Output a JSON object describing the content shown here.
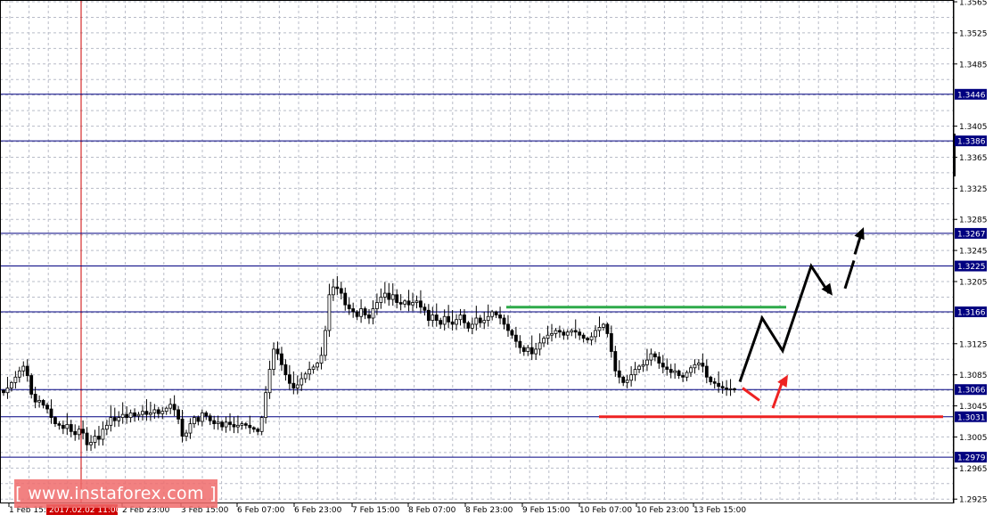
{
  "chart_data": {
    "type": "candlestick",
    "instrument_hint": "GBP/USD H1",
    "colors": {
      "candle": "#000000",
      "grid": "#b8bcc8",
      "level_line": "#000080",
      "tag_bg": "#000080",
      "crosshair": "#cc0000",
      "cursor_tag_bg": "#cc0000",
      "resistance_mark": "#2eaa4a",
      "support_mark": "#ee2222",
      "main_arrow": "#000000",
      "alt_arrow": "#ee2222"
    },
    "ylim": [
      1.2925,
      1.3575
    ],
    "y_ticks": [
      "1.3565",
      "1.3525",
      "1.3485",
      "1.3405",
      "1.3365",
      "1.3325",
      "1.3285",
      "1.3245",
      "1.3205",
      "1.3125",
      "1.3085",
      "1.3045",
      "1.3005",
      "1.2965",
      "1.2925"
    ],
    "x_ticks": [
      "1 Feb 15:00",
      "2 Feb 23:00",
      "3 Feb 15:00",
      "6 Feb 07:00",
      "6 Feb 23:00",
      "7 Feb 15:00",
      "8 Feb 07:00",
      "8 Feb 23:00",
      "9 Feb 15:00",
      "10 Feb 07:00",
      "10 Feb 23:00",
      "13 Feb 15:00"
    ],
    "cursor_time_label": "2017.02.02 11:00",
    "levels": [
      {
        "label": "1.3446",
        "value": 1.3446
      },
      {
        "label": "1.3386",
        "value": 1.3386
      },
      {
        "label": "1.3267",
        "value": 1.3267
      },
      {
        "label": "1.3225",
        "value": 1.3225
      },
      {
        "label": "1.3166",
        "value": 1.3166
      },
      {
        "label": "1.3066",
        "value": 1.3066
      },
      {
        "label": "1.3031",
        "value": 1.3031
      },
      {
        "label": "1.2979",
        "value": 1.2979
      }
    ],
    "resistance_zone": {
      "value": 1.3172
    },
    "support_zone": {
      "value": 1.3031
    },
    "closes": [
      1.3062,
      1.3068,
      1.3075,
      1.3082,
      1.309,
      1.3096,
      1.3084,
      1.306,
      1.305,
      1.3052,
      1.3046,
      1.3041,
      1.303,
      1.3022,
      1.302,
      1.3016,
      1.3021,
      1.3012,
      1.3008,
      1.3015,
      1.301,
      1.2995,
      1.2998,
      1.3006,
      1.3002,
      1.3015,
      1.302,
      1.303,
      1.3026,
      1.303,
      1.3034,
      1.303,
      1.3036,
      1.3032,
      1.3034,
      1.3038,
      1.3034,
      1.3036,
      1.304,
      1.3035,
      1.3038,
      1.3042,
      1.3047,
      1.304,
      1.3028,
      1.3006,
      1.301,
      1.3022,
      1.303,
      1.3025,
      1.3036,
      1.3032,
      1.3026,
      1.3022,
      1.3024,
      1.3018,
      1.3024,
      1.3021,
      1.3018,
      1.302,
      1.3022,
      1.302,
      1.3017,
      1.3015,
      1.3012,
      1.303,
      1.3062,
      1.3092,
      1.3118,
      1.3112,
      1.3098,
      1.3085,
      1.3074,
      1.3068,
      1.3072,
      1.308,
      1.3086,
      1.3092,
      1.3095,
      1.31,
      1.311,
      1.3142,
      1.3188,
      1.3198,
      1.3196,
      1.319,
      1.3175,
      1.317,
      1.3166,
      1.316,
      1.317,
      1.3162,
      1.3158,
      1.317,
      1.3178,
      1.3185,
      1.319,
      1.3182,
      1.3188,
      1.3178,
      1.3176,
      1.318,
      1.3175,
      1.3178,
      1.318,
      1.3172,
      1.3168,
      1.3155,
      1.3162,
      1.3155,
      1.315,
      1.316,
      1.3153,
      1.315,
      1.3156,
      1.3162,
      1.3152,
      1.3145,
      1.315,
      1.3158,
      1.3152,
      1.3155,
      1.316,
      1.3166,
      1.3162,
      1.3158,
      1.315,
      1.3142,
      1.3136,
      1.3128,
      1.312,
      1.3115,
      1.312,
      1.3112,
      1.3118,
      1.3126,
      1.3132,
      1.3136,
      1.3138,
      1.3142,
      1.314,
      1.3136,
      1.314,
      1.3142,
      1.314,
      1.3136,
      1.3132,
      1.313,
      1.3134,
      1.3142,
      1.3146,
      1.315,
      1.3138,
      1.3115,
      1.309,
      1.3082,
      1.3075,
      1.3078,
      1.3085,
      1.3092,
      1.3096,
      1.3098,
      1.3104,
      1.3112,
      1.3108,
      1.31,
      1.3095,
      1.3092,
      1.3088,
      1.309,
      1.3084,
      1.3082,
      1.3088,
      1.3094,
      1.3098,
      1.31,
      1.3096,
      1.3082,
      1.3076,
      1.3074,
      1.307,
      1.3068,
      1.3066,
      1.3067,
      1.3066
    ],
    "forecast_main_price": [
      1.3076,
      1.3158,
      1.3116,
      1.3225,
      1.319
    ],
    "forecast_main_cont_price": [
      1.3196,
      1.3232
    ],
    "forecast_main_arrow_price": [
      1.324,
      1.3275
    ],
    "forecast_alt_price": [
      1.3068,
      1.3052
    ],
    "forecast_alt_arrow_price": [
      1.3042,
      1.3085
    ]
  },
  "watermark": {
    "text": "[ www.instaforex.com ]"
  }
}
